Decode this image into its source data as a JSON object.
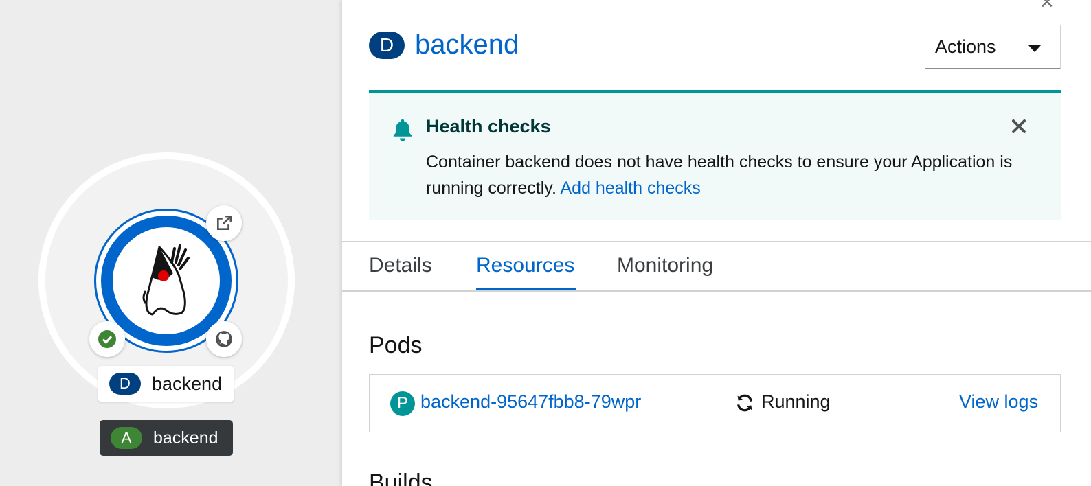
{
  "topology": {
    "node": {
      "kind_badge": "D",
      "name": "backend"
    },
    "application": {
      "kind_badge": "A",
      "name": "backend"
    }
  },
  "panel": {
    "title": {
      "kind_badge": "D",
      "name": "backend"
    },
    "actions_label": "Actions",
    "alert": {
      "heading": "Health checks",
      "body": "Container backend does not have health checks to ensure your Application is running correctly.",
      "link": "Add health checks"
    },
    "tabs": [
      {
        "label": "Details"
      },
      {
        "label": "Resources"
      },
      {
        "label": "Monitoring"
      }
    ],
    "active_tab": "Resources",
    "pods_section": {
      "title": "Pods",
      "pods": [
        {
          "kind_badge": "P",
          "name": "backend-95647fbb8-79wpr",
          "status": "Running",
          "action": "View logs"
        }
      ]
    },
    "next_section_title": "Builds"
  },
  "colors": {
    "primary_link": "#0066cc",
    "deployment_badge": "#004080",
    "application_badge": "#3e8635",
    "pod_badge": "#009596",
    "alert_border": "#009596",
    "success": "#3e8635"
  }
}
